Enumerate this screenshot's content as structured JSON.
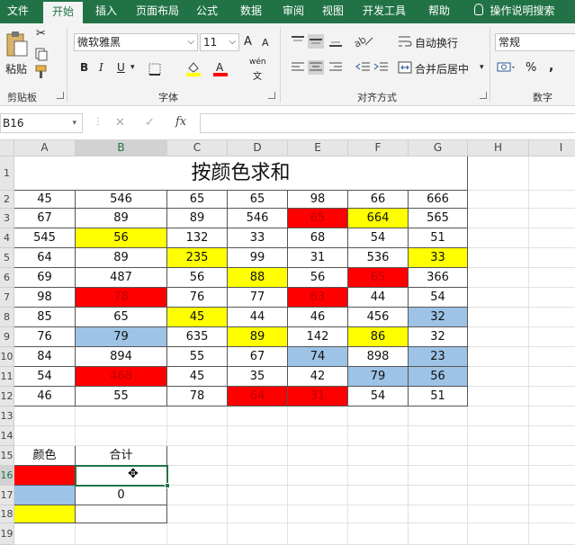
{
  "tabs": [
    "文件",
    "开始",
    "插入",
    "页面布局",
    "公式",
    "数据",
    "审阅",
    "视图",
    "开发工具",
    "帮助",
    "操作说明搜索"
  ],
  "active_tab": 1,
  "ribbon": {
    "clipboard": {
      "paste_label": "粘贴",
      "group_label": "剪贴板"
    },
    "font": {
      "font_name": "微软雅黑",
      "font_size": "11",
      "bold": "B",
      "italic": "I",
      "underline": "U",
      "grow": "A",
      "shrink": "A",
      "wen": "wén",
      "wen2": "文",
      "group_label": "字体"
    },
    "align": {
      "wrap_label": "自动换行",
      "merge_label": "合并后居中",
      "group_label": "对齐方式"
    },
    "number": {
      "format": "常规",
      "percent": "%",
      "comma": ",",
      "group_label": "数字"
    }
  },
  "formula_bar": {
    "name_box": "B16",
    "cancel": "✕",
    "enter": "✓",
    "fx": "fx",
    "value": ""
  },
  "columns": [
    "A",
    "B",
    "C",
    "D",
    "E",
    "F",
    "G",
    "H",
    "I"
  ],
  "selected_column": "B",
  "rows": [
    "1",
    "2",
    "3",
    "4",
    "5",
    "6",
    "7",
    "8",
    "9",
    "10",
    "11",
    "12",
    "13",
    "14",
    "15",
    "16",
    "17",
    "18",
    "19"
  ],
  "selected_row": "16",
  "title": "按颜色求和",
  "table": [
    [
      {
        "v": "45"
      },
      {
        "v": "546"
      },
      {
        "v": "65"
      },
      {
        "v": "65"
      },
      {
        "v": "98"
      },
      {
        "v": "66"
      },
      {
        "v": "666"
      }
    ],
    [
      {
        "v": "67"
      },
      {
        "v": "89"
      },
      {
        "v": "89"
      },
      {
        "v": "546"
      },
      {
        "v": "65",
        "c": "red"
      },
      {
        "v": "664",
        "c": "yellow"
      },
      {
        "v": "565"
      }
    ],
    [
      {
        "v": "545"
      },
      {
        "v": "56",
        "c": "yellow"
      },
      {
        "v": "132"
      },
      {
        "v": "33"
      },
      {
        "v": "68"
      },
      {
        "v": "54"
      },
      {
        "v": "51"
      }
    ],
    [
      {
        "v": "64"
      },
      {
        "v": "89"
      },
      {
        "v": "235",
        "c": "yellow"
      },
      {
        "v": "99"
      },
      {
        "v": "31"
      },
      {
        "v": "536"
      },
      {
        "v": "33",
        "c": "yellow"
      }
    ],
    [
      {
        "v": "69"
      },
      {
        "v": "487"
      },
      {
        "v": "56"
      },
      {
        "v": "88",
        "c": "yellow"
      },
      {
        "v": "56"
      },
      {
        "v": "65",
        "c": "red"
      },
      {
        "v": "366"
      }
    ],
    [
      {
        "v": "98"
      },
      {
        "v": "78",
        "c": "red"
      },
      {
        "v": "76"
      },
      {
        "v": "77"
      },
      {
        "v": "63",
        "c": "red"
      },
      {
        "v": "44"
      },
      {
        "v": "54"
      }
    ],
    [
      {
        "v": "85"
      },
      {
        "v": "65"
      },
      {
        "v": "45",
        "c": "yellow"
      },
      {
        "v": "44"
      },
      {
        "v": "46"
      },
      {
        "v": "456"
      },
      {
        "v": "32",
        "c": "blue"
      }
    ],
    [
      {
        "v": "76"
      },
      {
        "v": "79",
        "c": "blue"
      },
      {
        "v": "635"
      },
      {
        "v": "89",
        "c": "yellow"
      },
      {
        "v": "142"
      },
      {
        "v": "86",
        "c": "yellow"
      },
      {
        "v": "32"
      }
    ],
    [
      {
        "v": "84"
      },
      {
        "v": "894"
      },
      {
        "v": "55"
      },
      {
        "v": "67"
      },
      {
        "v": "74",
        "c": "blue"
      },
      {
        "v": "898"
      },
      {
        "v": "23",
        "c": "blue"
      }
    ],
    [
      {
        "v": "54"
      },
      {
        "v": "468",
        "c": "red"
      },
      {
        "v": "45"
      },
      {
        "v": "35"
      },
      {
        "v": "42"
      },
      {
        "v": "79",
        "c": "blue"
      },
      {
        "v": "56",
        "c": "blue"
      }
    ],
    [
      {
        "v": "46"
      },
      {
        "v": "55"
      },
      {
        "v": "78"
      },
      {
        "v": "64",
        "c": "red"
      },
      {
        "v": "31",
        "c": "red"
      },
      {
        "v": "54"
      },
      {
        "v": "51"
      }
    ]
  ],
  "summary": {
    "headers": [
      "颜色",
      "合计"
    ],
    "rows": [
      {
        "color": "red",
        "total": ""
      },
      {
        "color": "blue",
        "total": "0"
      },
      {
        "color": "yellow",
        "total": ""
      }
    ]
  },
  "colors": {
    "red": "#ff0000",
    "yellow": "#ffff00",
    "blue": "#9dc3e6",
    "accent": "#217346"
  }
}
